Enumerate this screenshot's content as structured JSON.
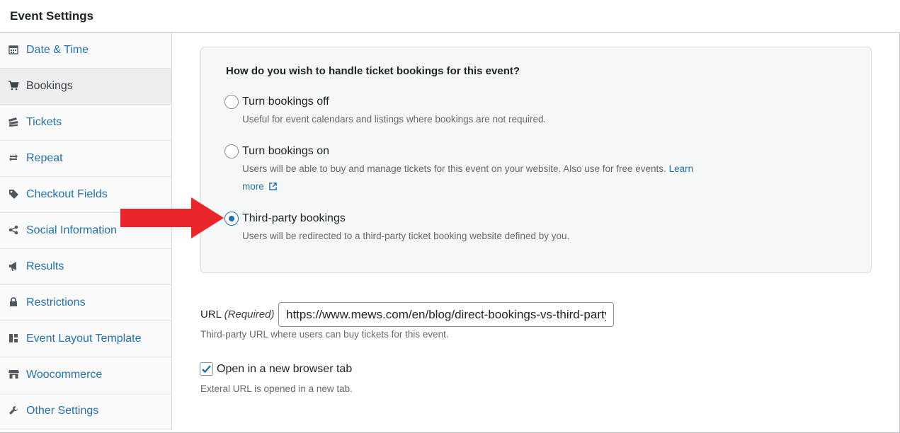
{
  "header": {
    "title": "Event Settings"
  },
  "sidebar": {
    "items": [
      {
        "label": "Date & Time",
        "icon": "calendar-icon",
        "active": false
      },
      {
        "label": "Bookings",
        "icon": "cart-icon",
        "active": true
      },
      {
        "label": "Tickets",
        "icon": "tickets-icon",
        "active": false
      },
      {
        "label": "Repeat",
        "icon": "repeat-icon",
        "active": false
      },
      {
        "label": "Checkout Fields",
        "icon": "tag-icon",
        "active": false
      },
      {
        "label": "Social Information",
        "icon": "share-icon",
        "active": false
      },
      {
        "label": "Results",
        "icon": "megaphone-icon",
        "active": false
      },
      {
        "label": "Restrictions",
        "icon": "lock-icon",
        "active": false
      },
      {
        "label": "Event Layout Template",
        "icon": "layout-icon",
        "active": false
      },
      {
        "label": "Woocommerce",
        "icon": "store-icon",
        "active": false
      },
      {
        "label": "Other Settings",
        "icon": "wrench-icon",
        "active": false
      }
    ]
  },
  "bookings": {
    "question": "How do you wish to handle ticket bookings for this event?",
    "options": [
      {
        "label": "Turn bookings off",
        "desc": "Useful for event calendars and listings where bookings are not required.",
        "checked": false
      },
      {
        "label": "Turn bookings on",
        "desc": "Users will be able to buy and manage tickets for this event on your website. Also use for free events.",
        "link_part1": "Learn",
        "link_part2": "more",
        "checked": false
      },
      {
        "label": "Third-party bookings",
        "desc": "Users will be redirected to a third-party ticket booking website defined by you.",
        "checked": true
      }
    ]
  },
  "url_field": {
    "label": "URL",
    "required": "(Required)",
    "value": "https://www.mews.com/en/blog/direct-bookings-vs-third-party-bookings",
    "help": "Third-party URL where users can buy tickets for this event."
  },
  "new_tab": {
    "label": "Open in a new browser tab",
    "checked": true,
    "help": "Exteral URL is opened in a new tab."
  },
  "colors": {
    "accent": "#2271b1",
    "arrow": "#e8262b",
    "link": "#2271b1"
  }
}
